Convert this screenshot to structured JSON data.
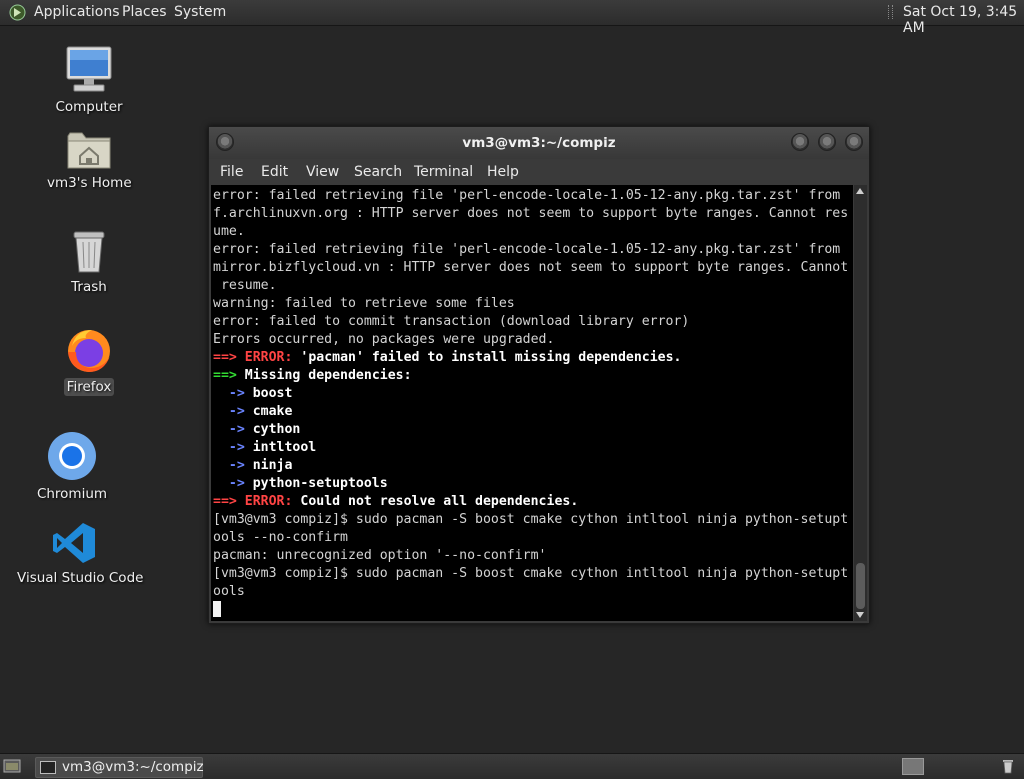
{
  "top_panel": {
    "menus": [
      "Applications",
      "Places",
      "System"
    ],
    "clock": "Sat Oct 19,  3:45 AM"
  },
  "desktop": {
    "icons": [
      {
        "label": "Computer",
        "icon": "computer-icon"
      },
      {
        "label": "vm3's Home",
        "icon": "home-folder-icon"
      },
      {
        "label": "Trash",
        "icon": "trash-icon"
      },
      {
        "label": "Firefox",
        "icon": "firefox-icon",
        "selected": true
      },
      {
        "label": "Chromium",
        "icon": "chromium-icon"
      },
      {
        "label": "Visual Studio Code",
        "icon": "vscode-icon"
      }
    ]
  },
  "terminal": {
    "title": "vm3@vm3:~/compiz",
    "menu": [
      "File",
      "Edit",
      "View",
      "Search",
      "Terminal",
      "Help"
    ],
    "lines": [
      "error: failed retrieving file 'perl-encode-locale-1.05-12-any.pkg.tar.zst' from",
      "f.archlinuxvn.org : HTTP server does not seem to support byte ranges. Cannot res",
      "ume.",
      "error: failed retrieving file 'perl-encode-locale-1.05-12-any.pkg.tar.zst' from",
      "mirror.bizflycloud.vn : HTTP server does not seem to support byte ranges. Cannot",
      " resume.",
      "warning: failed to retrieve some files",
      "error: failed to commit transaction (download library error)",
      "Errors occurred, no packages were upgraded.",
      {
        "arrow": "==>",
        "label": "ERROR:",
        "text": "'pacman' failed to install missing dependencies.",
        "style": "error"
      },
      {
        "arrow": "==>",
        "label": "",
        "text": "Missing dependencies:",
        "style": "info"
      },
      {
        "arrow": "  ->",
        "label": "",
        "text": "boost",
        "style": "dep"
      },
      {
        "arrow": "  ->",
        "label": "",
        "text": "cmake",
        "style": "dep"
      },
      {
        "arrow": "  ->",
        "label": "",
        "text": "cython",
        "style": "dep"
      },
      {
        "arrow": "  ->",
        "label": "",
        "text": "intltool",
        "style": "dep"
      },
      {
        "arrow": "  ->",
        "label": "",
        "text": "ninja",
        "style": "dep"
      },
      {
        "arrow": "  ->",
        "label": "",
        "text": "python-setuptools",
        "style": "dep"
      },
      {
        "arrow": "==>",
        "label": "ERROR:",
        "text": "Could not resolve all dependencies.",
        "style": "error"
      },
      "[vm3@vm3 compiz]$ sudo pacman -S boost cmake cython intltool ninja python-setupt",
      "ools --no-confirm",
      "pacman: unrecognized option '--no-confirm'",
      "[vm3@vm3 compiz]$ sudo pacman -S boost cmake cython intltool ninja python-setupt",
      "ools",
      {
        "cursor": true
      }
    ]
  },
  "taskbar": {
    "task_label": "vm3@vm3:~/compiz"
  },
  "colors": {
    "error": "#ff4444",
    "info_arrow": "#33dd33",
    "dep_arrow": "#6a84ff",
    "terminal_bg": "#000000",
    "desktop_bg": "#262626"
  }
}
